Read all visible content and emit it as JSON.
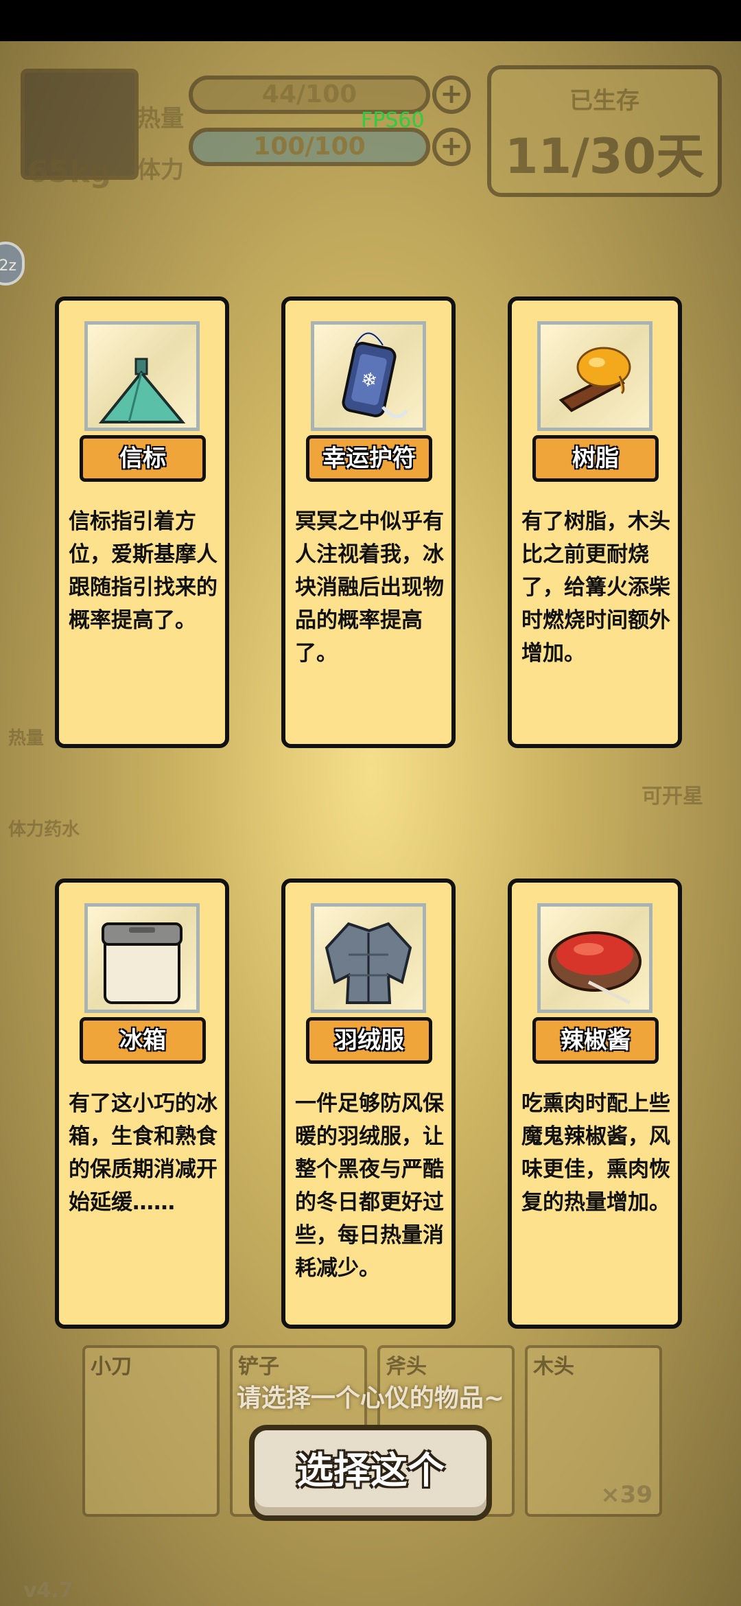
{
  "hud": {
    "weight": "65kg",
    "heat_label": "热量",
    "heat_value": "44/100",
    "stamina_label": "体力",
    "stamina_value": "100/100",
    "fps": "FPS60",
    "days_title": "已生存",
    "days_value": "11/30天",
    "side_label": "2z"
  },
  "background_labels": {
    "heat_potion": "热量",
    "stamina_potion": "体力药水",
    "openable": "可开星",
    "version": "v4.7"
  },
  "cards": [
    {
      "name": "信标",
      "description": "信标指引着方位，爱斯基摩人跟随指引找来的概率提高了。",
      "icon": "beacon-icon"
    },
    {
      "name": "幸运护符",
      "description": "冥冥之中似乎有人注视着我，冰块消融后出现物品的概率提高了。",
      "icon": "charm-icon"
    },
    {
      "name": "树脂",
      "description": "有了树脂，木头比之前更耐烧了，给篝火添柴时燃烧时间额外增加。",
      "icon": "resin-icon"
    },
    {
      "name": "冰箱",
      "description": "有了这小巧的冰箱，生食和熟食的保质期消减开始延缓……",
      "icon": "fridge-icon"
    },
    {
      "name": "羽绒服",
      "description": "一件足够防风保暖的羽绒服，让整个黑夜与严酷的冬日都更好过些，每日热量消耗减少。",
      "icon": "down-jacket-icon"
    },
    {
      "name": "辣椒酱",
      "description": "吃熏肉时配上些魔鬼辣椒酱，风味更佳，熏肉恢复的热量增加。",
      "icon": "chili-sauce-icon"
    }
  ],
  "inventory": {
    "slots": [
      {
        "label": "小刀",
        "count": ""
      },
      {
        "label": "铲子",
        "count": ""
      },
      {
        "label": "斧头",
        "count": ""
      },
      {
        "label": "木头",
        "count": "×39"
      }
    ]
  },
  "prompt": "请选择一个心仪的物品~",
  "select_button": "选择这个"
}
